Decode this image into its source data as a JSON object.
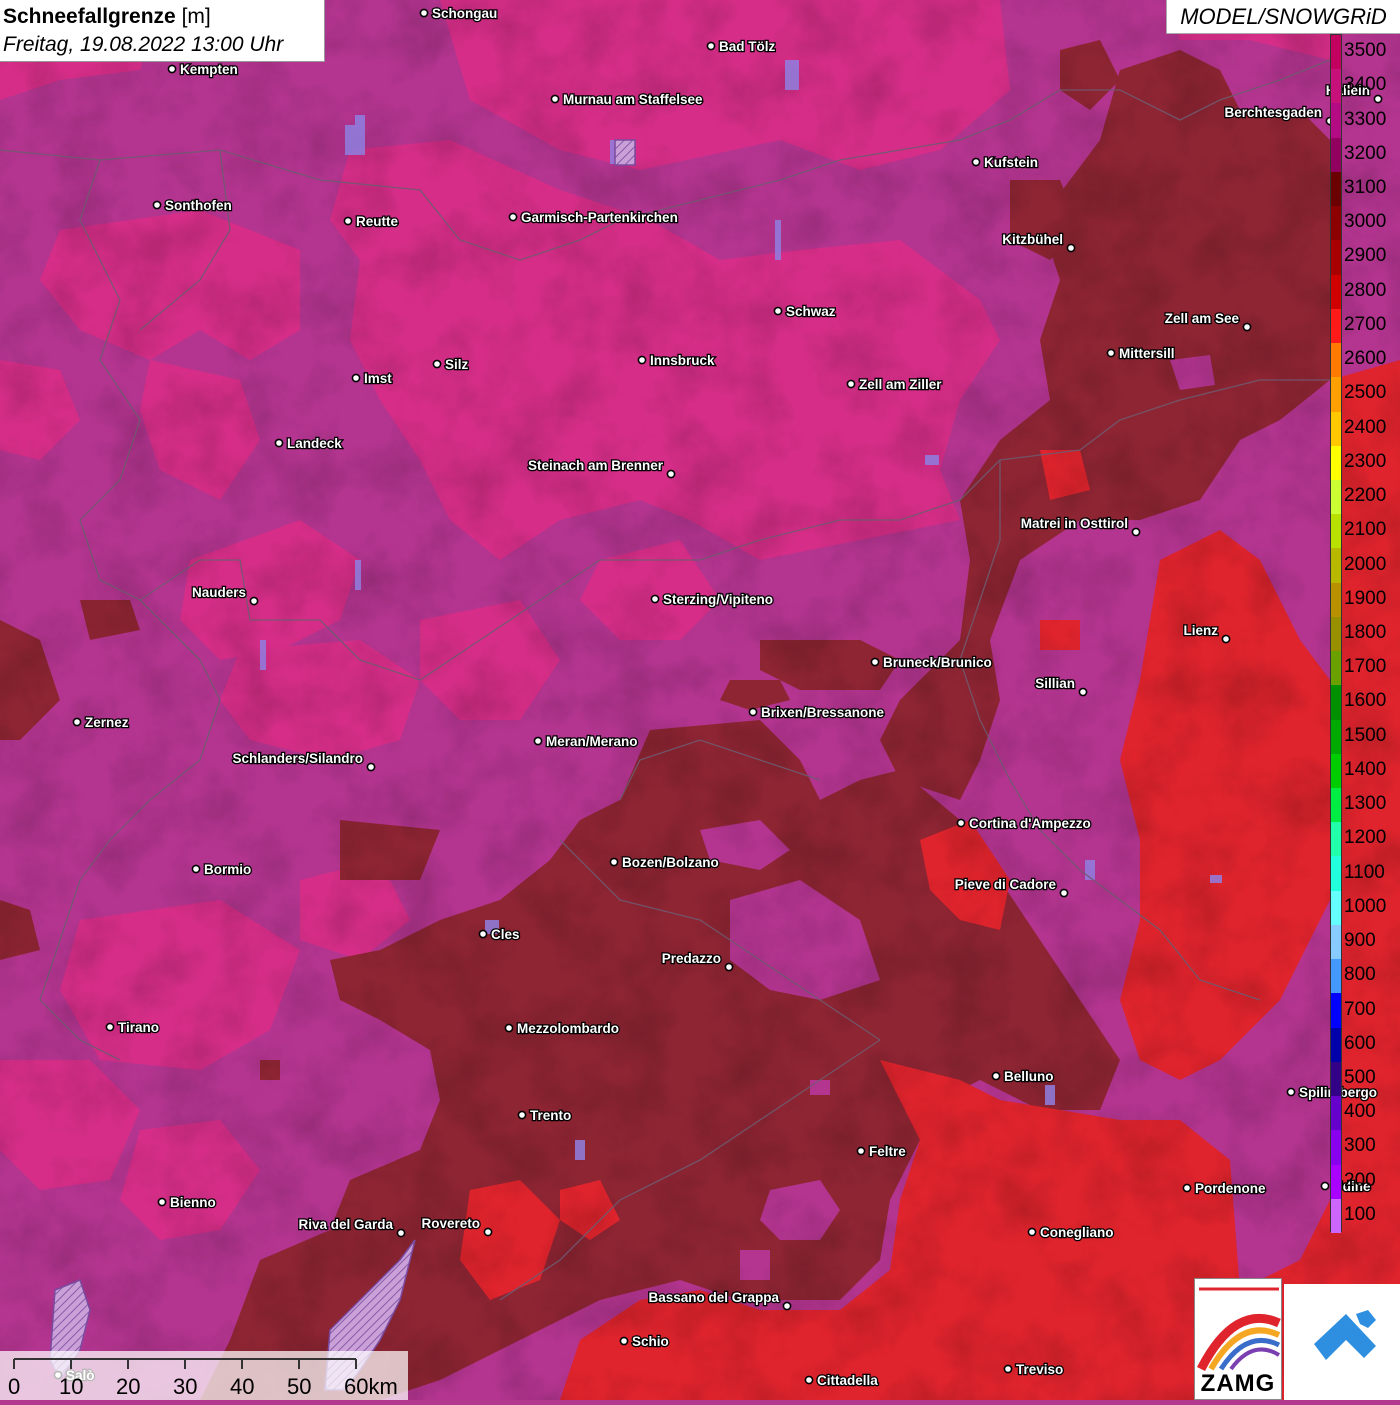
{
  "title": {
    "bold": "Schneefallgrenze",
    "unit": " [m]",
    "subtitle": "Freitag, 19.08.2022 13:00 Uhr"
  },
  "model_label": "MODEL/SNOWGRiD",
  "legend": {
    "labels": [
      "3500",
      "3400",
      "3300",
      "3200",
      "3100",
      "3000",
      "2900",
      "2800",
      "2700",
      "2600",
      "2500",
      "2400",
      "2300",
      "2200",
      "2100",
      "2000",
      "1900",
      "1800",
      "1700",
      "1600",
      "1500",
      "1400",
      "1300",
      "1200",
      "1100",
      "1000",
      "900",
      "800",
      "700",
      "600",
      "500",
      "400",
      "300",
      "200",
      "100"
    ],
    "colors": [
      "#c3005f",
      "#c8107a",
      "#b40a84",
      "#920060",
      "#6a0000",
      "#8c0000",
      "#a80000",
      "#d00000",
      "#ff1a1a",
      "#ff7a00",
      "#ffa000",
      "#ffc800",
      "#ffff00",
      "#ccff33",
      "#b8e000",
      "#b8b800",
      "#b89000",
      "#989000",
      "#6aa000",
      "#009000",
      "#00aa00",
      "#00cc00",
      "#00ee44",
      "#22ffaa",
      "#22ffdd",
      "#66ffff",
      "#88ccff",
      "#4499ff",
      "#0000ff",
      "#0000aa",
      "#330088",
      "#6600cc",
      "#8800ee",
      "#aa00ff",
      "#cc66ff"
    ]
  },
  "scale_bar": {
    "labels": [
      "0",
      "10",
      "20",
      "30",
      "40",
      "50",
      "60km"
    ]
  },
  "logos": {
    "zamg": "ZAMG"
  },
  "cities": [
    {
      "name": "Schongau"
    },
    {
      "name": "Bad Tölz"
    },
    {
      "name": "Kempten"
    },
    {
      "name": "Murnau am Staffelsee"
    },
    {
      "name": "Berchtesgaden"
    },
    {
      "name": "Hallein"
    },
    {
      "name": "Kufstein"
    },
    {
      "name": "Sonthofen"
    },
    {
      "name": "Reutte"
    },
    {
      "name": "Garmisch-Partenkirchen"
    },
    {
      "name": "Kitzbühel"
    },
    {
      "name": "Schwaz"
    },
    {
      "name": "Zell am See"
    },
    {
      "name": "Mittersill"
    },
    {
      "name": "Innsbruck"
    },
    {
      "name": "Imst"
    },
    {
      "name": "Silz"
    },
    {
      "name": "Zell am Ziller"
    },
    {
      "name": "Landeck"
    },
    {
      "name": "Steinach am Brenner"
    },
    {
      "name": "Matrei in Osttirol"
    },
    {
      "name": "Nauders"
    },
    {
      "name": "Sterzing/Vipiteno"
    },
    {
      "name": "Lienz"
    },
    {
      "name": "Bruneck/Brunico"
    },
    {
      "name": "Sillian"
    },
    {
      "name": "Zernez"
    },
    {
      "name": "Brixen/Bressanone"
    },
    {
      "name": "Meran/Merano"
    },
    {
      "name": "Schlanders/Silandro"
    },
    {
      "name": "Cortina d'Ampezzo"
    },
    {
      "name": "Bozen/Bolzano"
    },
    {
      "name": "Bormio"
    },
    {
      "name": "Pieve di Cadore"
    },
    {
      "name": "Cles"
    },
    {
      "name": "Predazzo"
    },
    {
      "name": "Tirano"
    },
    {
      "name": "Mezzolombardo"
    },
    {
      "name": "Belluno"
    },
    {
      "name": "Spilimbergo"
    },
    {
      "name": "Trento"
    },
    {
      "name": "Feltre"
    },
    {
      "name": "Pordenone"
    },
    {
      "name": "Bienno"
    },
    {
      "name": "Riva del Garda"
    },
    {
      "name": "Rovereto"
    },
    {
      "name": "Conegliano"
    },
    {
      "name": "Bassano del Grappa"
    },
    {
      "name": "Schio"
    },
    {
      "name": "Treviso"
    },
    {
      "name": "Cittadella"
    },
    {
      "name": "Salò"
    },
    {
      "name": "Udine"
    }
  ]
}
